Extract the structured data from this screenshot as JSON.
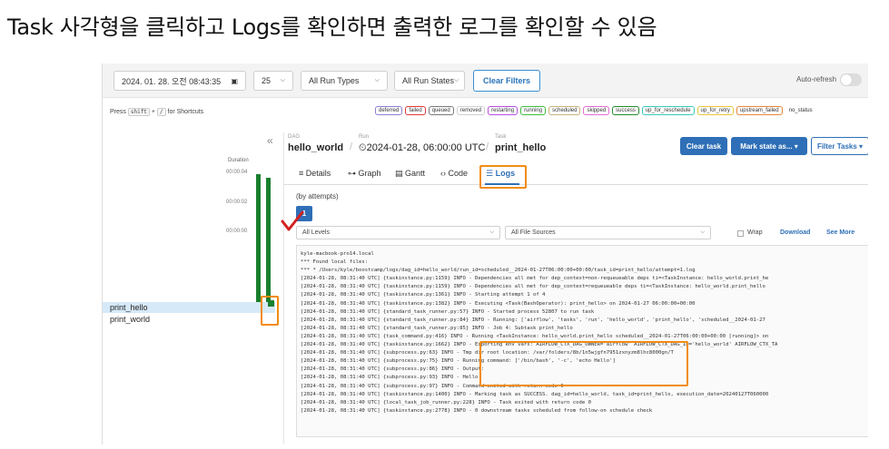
{
  "caption": "Task 사각형을 클릭하고 Logs를 확인하면 출력한 로그를 확인할 수 있음",
  "toolbar": {
    "date_value": "2024. 01. 28. 오전 08:43:35",
    "run_count": "25",
    "run_types": "All Run Types",
    "run_states": "All Run States",
    "clear_filters": "Clear Filters",
    "auto_refresh": "Auto-refresh"
  },
  "shortcuts": {
    "press": "Press",
    "key1": "shift",
    "plus": "+",
    "key2": "/",
    "suffix": "for Shortcuts"
  },
  "states": [
    {
      "label": "deferred",
      "color": "#8a7fd6"
    },
    {
      "label": "failed",
      "color": "#e23a3a"
    },
    {
      "label": "queued",
      "color": "#7a7a7a"
    },
    {
      "label": "removed",
      "color": "#cfcfcf"
    },
    {
      "label": "restarting",
      "color": "#b84ce0"
    },
    {
      "label": "running",
      "color": "#3cbf3c"
    },
    {
      "label": "scheduled",
      "color": "#c9b27a"
    },
    {
      "label": "skipped",
      "color": "#e26fd0"
    },
    {
      "label": "success",
      "color": "#1f8c2a"
    },
    {
      "label": "up_for_reschedule",
      "color": "#38c9bd"
    },
    {
      "label": "up_for_retry",
      "color": "#e8c53a"
    },
    {
      "label": "upstream_failed",
      "color": "#e8873a"
    },
    {
      "label": "no_status",
      "color": "#ffffff"
    }
  ],
  "grid": {
    "duration_label": "Duration",
    "ticks": [
      "00:00:04",
      "00:00:02",
      "00:00:00"
    ],
    "tasks": [
      "print_hello",
      "print_world"
    ]
  },
  "breadcrumb": {
    "dag_label": "DAG",
    "dag_value": "hello_world",
    "run_label": "Run",
    "run_value": "2024-01-28, 06:00:00 UTC",
    "task_label": "Task",
    "task_value": "print_hello"
  },
  "actions": {
    "clear_task": "Clear task",
    "mark_state": "Mark state as...",
    "filter_tasks": "Filter Tasks"
  },
  "tabs": [
    "Details",
    "Graph",
    "Gantt",
    "Code",
    "Logs"
  ],
  "logs": {
    "attempts_label": "(by attempts)",
    "attempt_number": "1",
    "levels": "All Levels",
    "sources": "All File Sources",
    "wrap": "Wrap",
    "download": "Download",
    "see_more": "See More",
    "lines": [
      "kyle-macbook-pro14.local",
      "*** Found local files:",
      "***   * /Users/kyle/boostcamp/logs/dag_id=hello_world/run_id=scheduled__2024-01-27T06:00:00+00:00/task_id=print_hello/attempt=1.log",
      "[2024-01-28, 08:31:40 UTC] {taskinstance.py:1159} INFO - Dependencies all met for dep_context=non-requeueable deps ti=<TaskInstance: hello_world.print_he",
      "[2024-01-28, 08:31:40 UTC] {taskinstance.py:1159} INFO - Dependencies all met for dep_context=requeueable deps ti=<TaskInstance: hello_world.print_hello",
      "[2024-01-28, 08:31:40 UTC] {taskinstance.py:1361} INFO - Starting attempt 1 of 4",
      "[2024-01-28, 08:31:40 UTC] {taskinstance.py:1382} INFO - Executing <Task(BashOperator): print_hello> on 2024-01-27 06:00:00+00:00",
      "[2024-01-28, 08:31:40 UTC] {standard_task_runner.py:57} INFO - Started process 52807 to run task",
      "[2024-01-28, 08:31:40 UTC] {standard_task_runner.py:84} INFO - Running: ['airflow', 'tasks', 'run', 'hello_world', 'print_hello', 'scheduled__2024-01-27",
      "[2024-01-28, 08:31:40 UTC] {standard_task_runner.py:85} INFO - Job 4: Subtask print_hello",
      "[2024-01-28, 08:31:40 UTC] {task_command.py:416} INFO - Running <TaskInstance: hello_world.print_hello scheduled__2024-01-27T06:00:00+00:00 [running]> on",
      "[2024-01-28, 08:31:40 UTC] {taskinstance.py:1662} INFO - Exporting env vars: AIRFLOW_CTX_DAG_OWNER='airflow' AIRFLOW_CTX_DAG_ID='hello_world' AIRFLOW_CTX_TA",
      "[2024-01-28, 08:31:40 UTC] {subprocess.py:63} INFO - Tmp dir root location: /var/folders/8b/1n5wjgfn7951zxnyzm8lhc8000gn/T",
      "[2024-01-28, 08:31:40 UTC] {subprocess.py:75} INFO - Running command: ['/bin/bash', '-c', 'echo Hello']",
      "[2024-01-28, 08:31:40 UTC] {subprocess.py:86} INFO - Output:",
      "[2024-01-28, 08:31:40 UTC] {subprocess.py:93} INFO - Hello",
      "[2024-01-28, 08:31:40 UTC] {subprocess.py:97} INFO - Command exited with return code 0",
      "[2024-01-28, 08:31:40 UTC] {taskinstance.py:1400} INFO - Marking task as SUCCESS. dag_id=hello_world, task_id=print_hello, execution_date=20240127T060000",
      "[2024-01-28, 08:31:40 UTC] {local_task_job_runner.py:228} INFO - Task exited with return code 0",
      "[2024-01-28, 08:31:40 UTC] {taskinstance.py:2778} INFO - 0 downstream tasks scheduled from follow-on schedule check"
    ]
  },
  "colors": {
    "accent": "#2e6fb7",
    "highlight": "#f28c14",
    "success": "#1a7f2e",
    "checkmark": "#d42020"
  }
}
